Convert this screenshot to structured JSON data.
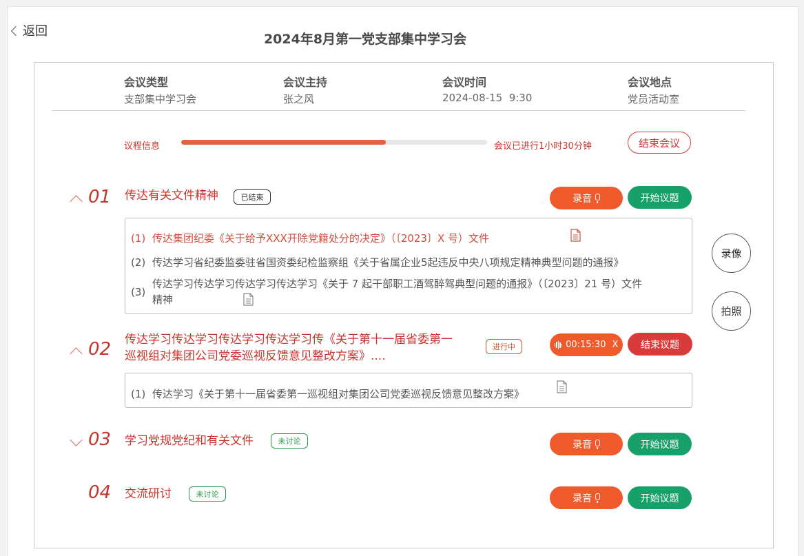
{
  "nav": {
    "back_label": "返回"
  },
  "page_title": "2024年8月第一党支部集中学习会",
  "meeting_info": [
    {
      "label": "会议类型",
      "value": "支部集中学习会"
    },
    {
      "label": "会议主持",
      "value": "张之风"
    },
    {
      "label": "会议时间",
      "value": "2024-08-15  9:30"
    },
    {
      "label": "会议地点",
      "value": "党员活动室"
    }
  ],
  "progress": {
    "label": "议程信息",
    "fraction": 0.67,
    "status": "会议已进行1小时30分钟",
    "end_button": "结束会议"
  },
  "side_buttons": {
    "video": "录像",
    "photo": "拍照"
  },
  "colors": {
    "accent_red": "#c8352e",
    "record_orange": "#ee5a2c",
    "start_green": "#18a06a",
    "stop_red": "#d93a3a"
  },
  "agenda": [
    {
      "num": "01",
      "expanded": true,
      "title": "传达有关文件精神",
      "status": "已结束",
      "record_label": "录音",
      "action_label": "开始议题",
      "docs": [
        {
          "idx": "(1)",
          "text": "传达集团纪委《关于给予XXX开除党籍处分的决定》（〔2023〕X 号）文件"
        },
        {
          "idx": "(2)",
          "text": "传达学习省纪委监委驻省国资委纪检监察组《关于省属企业5起违反中央八项规定精神典型问题的通报》"
        },
        {
          "idx": "(3)",
          "text_line1": "传达学习传达学习传达学习传达学习《关于 7 起干部职工酒驾醉驾典型问题的通报》（〔2023〕21 号）文件",
          "text_line2": "精神"
        }
      ]
    },
    {
      "num": "02",
      "expanded": true,
      "title_line1": "传达学习传达学习传达学习传达学习传《关于第十一届省委第一",
      "title_line2": "巡视组对集团公司党委巡视反馈意见整改方案》....",
      "status": "进行中",
      "timer": "00:15:30",
      "timer_close": "X",
      "action_label": "结束议题",
      "docs": [
        {
          "idx": "(1)",
          "text": "传达学习《关于第十一届省委第一巡视组对集团公司党委巡视反馈意见整改方案》"
        }
      ]
    },
    {
      "num": "03",
      "expanded": false,
      "title": "学习党规党纪和有关文件",
      "status": "未讨论",
      "record_label": "录音",
      "action_label": "开始议题"
    },
    {
      "num": "04",
      "title": "交流研讨",
      "status": "未讨论",
      "record_label": "录音",
      "action_label": "开始议题"
    }
  ]
}
